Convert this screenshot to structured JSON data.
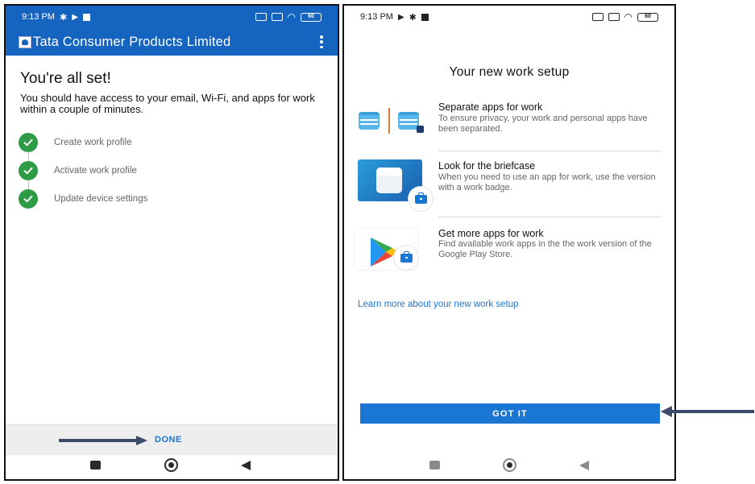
{
  "left_screen": {
    "status_time": "9:13 PM",
    "battery": "60",
    "app_title": "Tata Consumer Products Limited",
    "heading": "You're all set!",
    "description": "You should have access to your email, Wi-Fi, and apps for work within a couple of minutes.",
    "steps": [
      {
        "label": "Create work profile",
        "status": "done"
      },
      {
        "label": "Activate work profile",
        "status": "done"
      },
      {
        "label": "Update device settings",
        "status": "done"
      }
    ],
    "done_label": "DONE"
  },
  "right_screen": {
    "status_time": "9:13 PM",
    "battery": "60",
    "heading": "Your new work setup",
    "features": [
      {
        "title": "Separate apps for work",
        "description": "To ensure privacy, your work and personal apps have been separated.",
        "icon": "calendar-pair-icon"
      },
      {
        "title": "Look for the briefcase",
        "description": "When you need to use an app for work, use the version with a work badge.",
        "icon": "cube-briefcase-icon"
      },
      {
        "title": "Get more apps for work",
        "description": "Find available work apps in the the work version of the Google Play Store.",
        "icon": "play-store-briefcase-icon"
      }
    ],
    "learn_more_link": "Learn more about your new work setup",
    "got_it_label": "GOT IT"
  },
  "colors": {
    "primary": "#1565c0",
    "button": "#1976d2",
    "check_green": "#2e9c47",
    "annotation_arrow": "#3b4a6b"
  }
}
